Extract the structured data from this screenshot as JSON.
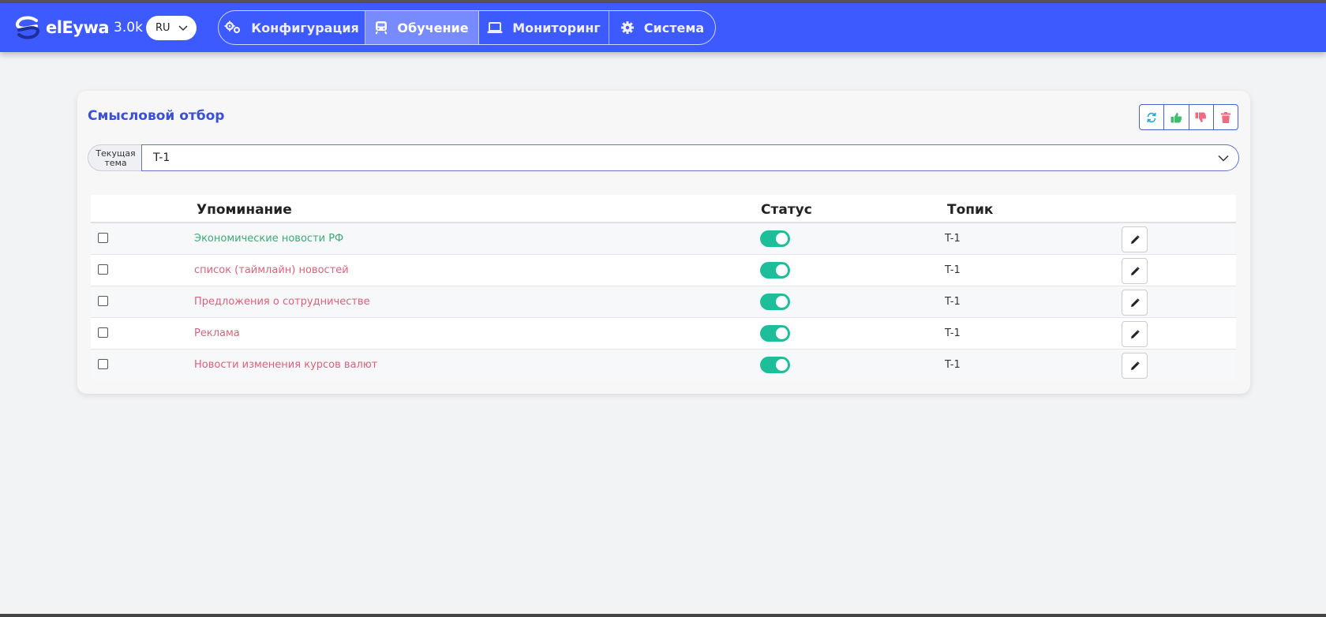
{
  "app": {
    "brand_name": "elEywa",
    "version": "3.0k",
    "language": "RU"
  },
  "nav": {
    "tabs": [
      {
        "label": "Конфигурация",
        "icon": "gears-icon"
      },
      {
        "label": "Обучение",
        "icon": "train-icon",
        "active": true
      },
      {
        "label": "Мониторинг",
        "icon": "laptop-icon"
      },
      {
        "label": "Система",
        "icon": "gear-icon"
      }
    ]
  },
  "card": {
    "title": "Смысловой отбор",
    "actions": [
      "refresh-icon",
      "thumbs-up-icon",
      "thumbs-down-icon",
      "trash-icon"
    ],
    "theme_label_line1": "Текущая",
    "theme_label_line2": "тема",
    "theme_value": "T-1"
  },
  "table": {
    "headers": {
      "mention": "Упоминание",
      "status": "Статус",
      "topic": "Топик"
    },
    "rows": [
      {
        "mention": "Экономические новости РФ",
        "mention_color": "#3daa75",
        "status_on": true,
        "topic": "T-1"
      },
      {
        "mention": "список (таймлайн) новостей",
        "mention_color": "#e0607a",
        "status_on": true,
        "topic": "T-1"
      },
      {
        "mention": "Предложения о сотрудничестве",
        "mention_color": "#e0607a",
        "status_on": true,
        "topic": "T-1"
      },
      {
        "mention": "Реклама",
        "mention_color": "#e0607a",
        "status_on": true,
        "topic": "T-1"
      },
      {
        "mention": "Новости изменения курсов валют",
        "mention_color": "#e0607a",
        "status_on": true,
        "topic": "T-1"
      }
    ]
  },
  "colors": {
    "navbar": "#3d5afe",
    "accent": "#3a50d9",
    "toggle_on": "#1dbf9b",
    "like": "#3bbf6f",
    "dislike": "#f06a80"
  }
}
